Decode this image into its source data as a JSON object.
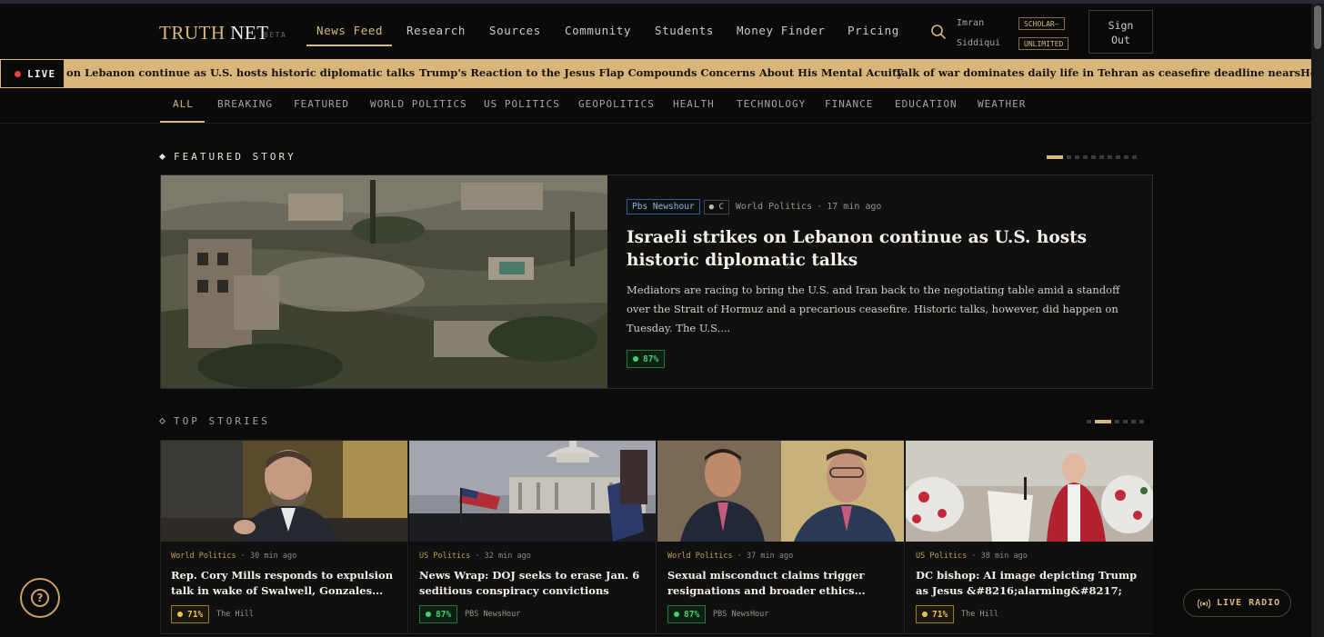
{
  "header": {
    "logo_part1": "TRUTH",
    "logo_part2": "NET",
    "beta": "BETA",
    "nav": [
      "News Feed",
      "Research",
      "Sources",
      "Community",
      "Students",
      "Money Finder",
      "Pricing"
    ],
    "user_first": "Imran",
    "user_last": "Siddiqui",
    "plan_line1": "SCHOLAR—",
    "plan_line2": "UNLIMITED",
    "signout_line1": "Sign",
    "signout_line2": "Out"
  },
  "ticker": {
    "live_label": "LIVE",
    "items": [
      "on Lebanon continue as U.S. hosts historic diplomatic talks",
      "Trump's Reaction to the Jesus Flap Compounds Concerns About His Mental Acuity",
      "Talk of war dominates daily life in Tehran as ceasefire deadline nears",
      "Ho"
    ]
  },
  "categories": [
    "ALL",
    "BREAKING",
    "FEATURED",
    "WORLD POLITICS",
    "US POLITICS",
    "GEOPOLITICS",
    "HEALTH",
    "TECHNOLOGY",
    "FINANCE",
    "EDUCATION",
    "WEATHER"
  ],
  "featured": {
    "section_label": "FEATURED STORY",
    "source": "Pbs Newshour",
    "rating_chip": "C",
    "category": "World Politics",
    "time": "17 min ago",
    "title": "Israeli strikes on Lebanon continue as U.S. hosts historic diplomatic talks",
    "description": "Mediators are racing to bring the U.S. and Iran back to the negotiating table amid a standoff over the Strait of Hormuz and a precarious ceasefire. Historic talks, however, did happen on Tuesday. The U.S....",
    "score": "87%"
  },
  "top_stories": {
    "section_label": "TOP STORIES",
    "cards": [
      {
        "category": "World Politics",
        "time": "30 min ago",
        "title": "Rep. Cory Mills responds to expulsion talk in wake of Swalwell, Gonzales...",
        "score": "71%",
        "score_color": "yellow",
        "source": "The Hill"
      },
      {
        "category": "US Politics",
        "time": "32 min ago",
        "title": "News Wrap: DOJ seeks to erase Jan. 6 seditious conspiracy convictions",
        "score": "87%",
        "score_color": "green",
        "source": "PBS NewsHour"
      },
      {
        "category": "World Politics",
        "time": "37 min ago",
        "title": "Sexual misconduct claims trigger resignations and broader ethics...",
        "score": "87%",
        "score_color": "green",
        "source": "PBS NewsHour"
      },
      {
        "category": "US Politics",
        "time": "38 min ago",
        "title": "DC bishop: AI image depicting Trump as Jesus &#8216;alarming&#8217;",
        "score": "71%",
        "score_color": "yellow",
        "source": "The Hill"
      }
    ]
  },
  "floating": {
    "help_glyph": "?",
    "radio_label": "LIVE RADIO"
  },
  "colors": {
    "accent": "#d9b87c",
    "background": "#0b0b0b",
    "ticker_bg": "#d8b57b",
    "score_green": "#45d06f",
    "score_yellow": "#f0c44a",
    "live_red": "#e14343"
  },
  "icons": {
    "search": "search-icon",
    "help": "question-circle-icon",
    "radio": "broadcast-icon"
  }
}
